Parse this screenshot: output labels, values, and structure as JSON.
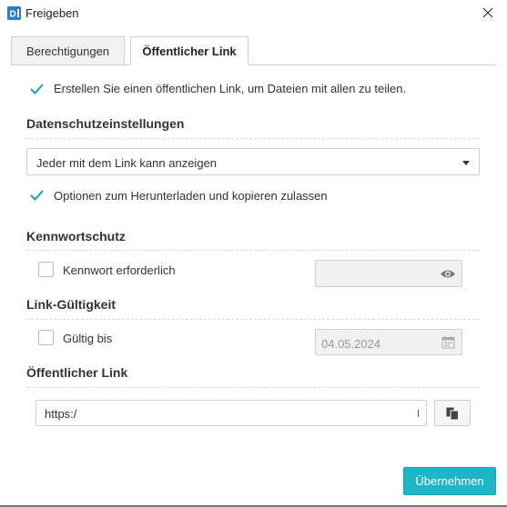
{
  "window": {
    "title": "Freigeben",
    "close_glyph": "✕"
  },
  "tabs": [
    {
      "label": "Berechtigungen",
      "active": false
    },
    {
      "label": "Öffentlicher Link",
      "active": true
    }
  ],
  "public_link_checkbox": {
    "label": "Erstellen Sie einen öffentlichen Link, um Dateien mit allen zu teilen.",
    "checked": true
  },
  "privacy": {
    "title": "Datenschutzeinstellungen",
    "dropdown_value": "Jeder mit dem Link kann anzeigen",
    "download_checkbox_label": "Optionen zum Herunterladen und kopieren zulassen",
    "download_checked": true
  },
  "password": {
    "title": "Kennwortschutz",
    "checkbox_label": "Kennwort erforderlich",
    "checked": false,
    "value": ""
  },
  "validity": {
    "title": "Link-Gültigkeit",
    "checkbox_label": "Gültig bis",
    "checked": false,
    "date": "04.05.2024"
  },
  "public_link": {
    "title": "Öffentlicher Link",
    "url": "https:/"
  },
  "apply_button": "Übernehmen",
  "colors": {
    "accent": "#1fb5c9",
    "checkbox": "#1a9fb8"
  }
}
